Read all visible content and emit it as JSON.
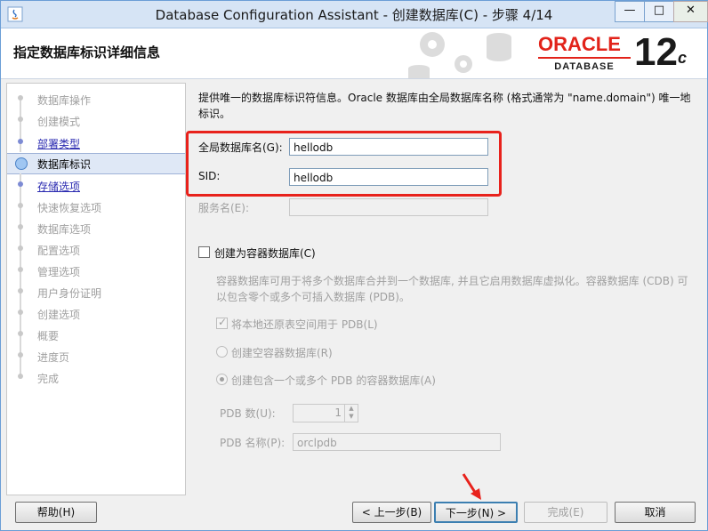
{
  "window": {
    "title": "Database Configuration Assistant - 创建数据库(C) - 步骤 4/14",
    "minimize": "—",
    "maximize": "□",
    "close": "✕"
  },
  "header": {
    "title": "指定数据库标识详细信息",
    "logo_oracle": "ORACLE",
    "logo_database": "DATABASE",
    "version": "12",
    "version_suffix": "c"
  },
  "steps": [
    {
      "label": "数据库操作",
      "state": "disabled"
    },
    {
      "label": "创建模式",
      "state": "disabled"
    },
    {
      "label": "部署类型",
      "state": "done"
    },
    {
      "label": "数据库标识",
      "state": "current"
    },
    {
      "label": "存储选项",
      "state": "done"
    },
    {
      "label": "快速恢复选项",
      "state": "disabled"
    },
    {
      "label": "数据库选项",
      "state": "disabled"
    },
    {
      "label": "配置选项",
      "state": "disabled"
    },
    {
      "label": "管理选项",
      "state": "disabled"
    },
    {
      "label": "用户身份证明",
      "state": "disabled"
    },
    {
      "label": "创建选项",
      "state": "disabled"
    },
    {
      "label": "概要",
      "state": "disabled"
    },
    {
      "label": "进度页",
      "state": "disabled"
    },
    {
      "label": "完成",
      "state": "disabled"
    }
  ],
  "content": {
    "description": "提供唯一的数据库标识符信息。Oracle 数据库由全局数据库名称 (格式通常为 \"name.domain\") 唯一地标识。",
    "global_db_label": "全局数据库名(G):",
    "global_db_value": "hellodb",
    "sid_label": "SID:",
    "sid_value": "hellodb",
    "service_label": "服务名(E):",
    "service_value": "",
    "cdb_checkbox_label": "创建为容器数据库(C)",
    "cdb_description": "容器数据库可用于将多个数据库合并到一个数据库, 并且它启用数据库虚拟化。容器数据库 (CDB) 可以包含零个或多个可插入数据库 (PDB)。",
    "local_undo_label": "将本地还原表空间用于 PDB(L)",
    "empty_cdb_label": "创建空容器数据库(R)",
    "cdb_with_pdb_label": "创建包含一个或多个 PDB 的容器数据库(A)",
    "pdb_count_label": "PDB 数(U):",
    "pdb_count_value": "1",
    "pdb_name_label": "PDB 名称(P):",
    "pdb_name_value": "orclpdb"
  },
  "footer": {
    "help": "帮助(H)",
    "back": "< 上一步(B)",
    "next": "下一步(N) >",
    "finish": "完成(E)",
    "cancel": "取消"
  },
  "colors": {
    "annotation_red": "#e8221c",
    "oracle_red": "#e2231a",
    "link_blue": "#2a2ab0"
  }
}
